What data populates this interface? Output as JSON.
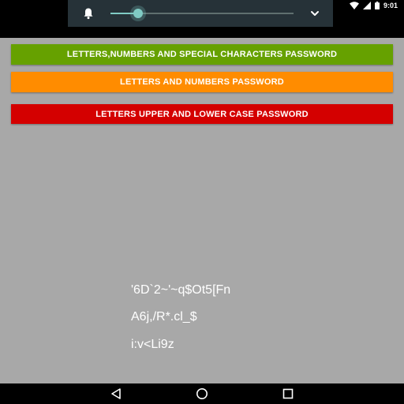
{
  "status_bar": {
    "time": "9:01",
    "icons": [
      "wifi-icon",
      "signal-icon",
      "battery-icon"
    ]
  },
  "volume_panel": {
    "icon": "bell-icon",
    "level_percent": 15,
    "expand_icon": "chevron-down-icon"
  },
  "buttons": {
    "letters_numbers_special": "LETTERS,NUMBERS AND SPECIAL CHARACTERS PASSWORD",
    "letters_numbers": "LETTERS AND NUMBERS PASSWORD",
    "letters_upper_lower": "LETTERS UPPER AND LOWER CASE PASSWORD"
  },
  "passwords": {
    "special": "'6D`2~'~q$Ot5[Fn",
    "numbers": "A6j,/R*.cl_$",
    "letters": "i:v<Li9z"
  },
  "nav_bar": {
    "back": "back-icon",
    "home": "home-icon",
    "recents": "recents-icon"
  },
  "colors": {
    "background": "#a8a8a8",
    "green_button": "#66a100",
    "orange_button": "#ff8c00",
    "red_button": "#d40000",
    "slider_accent": "#80cbc4",
    "volume_panel": "#263238"
  }
}
